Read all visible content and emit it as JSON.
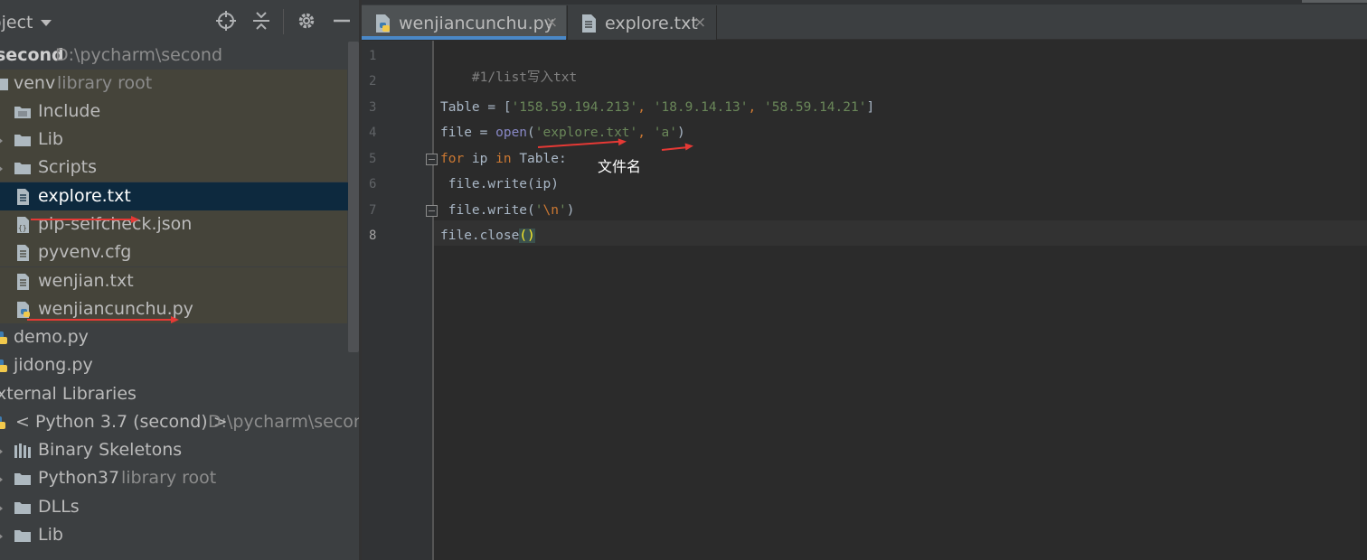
{
  "project_panel": {
    "title": "oject",
    "tree": [
      {
        "label": "second",
        "sub": "D:\\pycharm\\second",
        "kind": "root"
      },
      {
        "label": "venv",
        "sub": "library root",
        "kind": "folder-open"
      },
      {
        "label": "Include",
        "sub": "",
        "kind": "folder"
      },
      {
        "label": "Lib",
        "sub": "",
        "kind": "folder"
      },
      {
        "label": "Scripts",
        "sub": "",
        "kind": "folder"
      },
      {
        "label": "explore.txt",
        "sub": "",
        "kind": "text-file"
      },
      {
        "label": "pip-selfcheck.json",
        "sub": "",
        "kind": "json-file"
      },
      {
        "label": "pyvenv.cfg",
        "sub": "",
        "kind": "text-file"
      },
      {
        "label": "wenjian.txt",
        "sub": "",
        "kind": "text-file"
      },
      {
        "label": "wenjiancunchu.py",
        "sub": "",
        "kind": "python-file"
      },
      {
        "label": "demo.py",
        "sub": "",
        "kind": "python-file"
      },
      {
        "label": "jidong.py",
        "sub": "",
        "kind": "python-file"
      },
      {
        "label": "xternal Libraries",
        "sub": "",
        "kind": "libraries"
      },
      {
        "label": "< Python 3.7 (second) >",
        "sub": "D:\\pycharm\\second",
        "kind": "python-sdk"
      },
      {
        "label": "Binary Skeletons",
        "sub": "",
        "kind": "skeletons"
      },
      {
        "label": "Python37",
        "sub": "library root",
        "kind": "folder"
      },
      {
        "label": "DLLs",
        "sub": "",
        "kind": "folder"
      },
      {
        "label": "Lib",
        "sub": "",
        "kind": "folder"
      }
    ]
  },
  "tabs": [
    {
      "label": "wenjiancunchu.py",
      "close": "×",
      "icon": "python-file-icon",
      "active": true
    },
    {
      "label": "explore.txt",
      "close": "×",
      "icon": "text-file-icon",
      "active": false
    }
  ],
  "editor": {
    "line_numbers": [
      "1",
      "2",
      "3",
      "4",
      "5",
      "6",
      "7",
      "8"
    ],
    "current_line": "8",
    "code": {
      "l1": "#1/list写入txt",
      "l3_a": "Table = [",
      "l3_s1": "'158.59.194.213'",
      "l3_sep1": ", ",
      "l3_s2": "'18.9.14.13'",
      "l3_sep2": ", ",
      "l3_s3": "'58.59.14.21'",
      "l3_b": "]",
      "l4_a": "file = ",
      "l4_open": "open",
      "l4_p": "(",
      "l4_s1": "'explore.txt'",
      "l4_sep": ", ",
      "l4_s2": "'a'",
      "l4_e": ")",
      "l5_for": "for",
      "l5_mid": " ip ",
      "l5_in": "in",
      "l5_end": " Table:",
      "l6": " file.write(ip)",
      "l7_a": " file.write(",
      "l7_q1": "'",
      "l7_esc": "\\n",
      "l7_q2": "'",
      "l7_e": ")",
      "l8_a": "file.close",
      "l8_paren": "()"
    },
    "annotation": "文件名"
  },
  "colors": {
    "panel_bg": "#3c3f41",
    "editor_bg": "#2b2b2b",
    "selection": "#0d293e",
    "active_tab_underline": "#4a88c7",
    "annotation_arrow": "#e53935"
  }
}
